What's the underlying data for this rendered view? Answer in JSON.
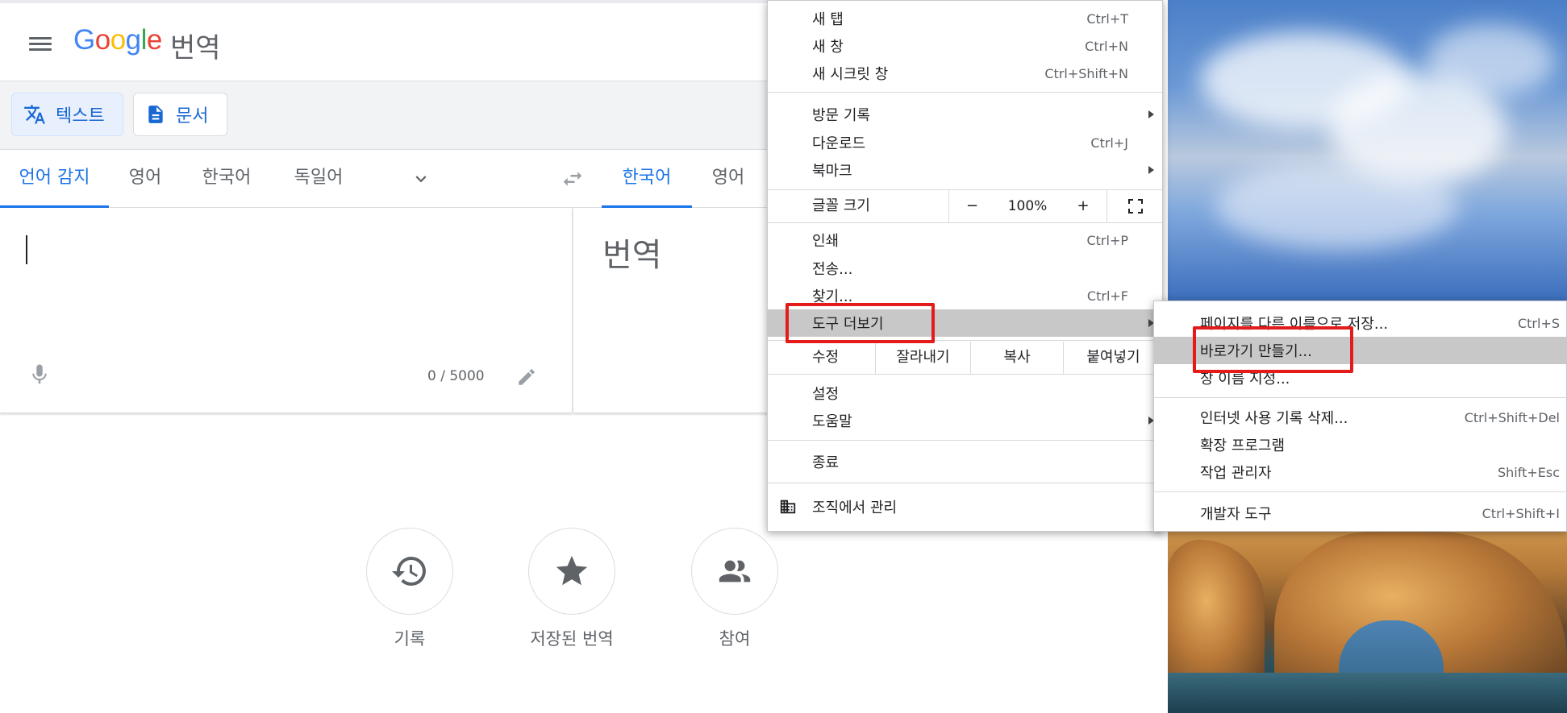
{
  "translate": {
    "logo": {
      "g": "G",
      "o1": "o",
      "o2": "o",
      "g2": "g",
      "l": "l",
      "e": "e"
    },
    "product_name": "번역",
    "modes": {
      "text": "텍스트",
      "document": "문서"
    },
    "source_langs": {
      "detect": "언어 감지",
      "english": "영어",
      "korean": "한국어",
      "german": "독일어"
    },
    "target_langs": {
      "korean": "한국어",
      "english": "영어"
    },
    "source_input": {
      "value": ""
    },
    "char_count": "0 / 5000",
    "target_placeholder": "번역",
    "actions": {
      "history": "기록",
      "saved": "저장된 번역",
      "community": "참여"
    },
    "colors": {
      "accent": "#1a73e8",
      "selected_bg": "#e8f0fe"
    }
  },
  "chrome_menu": {
    "items": {
      "new_tab": {
        "label": "새 탭",
        "shortcut": "Ctrl+T"
      },
      "new_window": {
        "label": "새 창",
        "shortcut": "Ctrl+N"
      },
      "incognito": {
        "label": "새 시크릿 창",
        "shortcut": "Ctrl+Shift+N"
      },
      "history": {
        "label": "방문 기록"
      },
      "downloads": {
        "label": "다운로드",
        "shortcut": "Ctrl+J"
      },
      "bookmarks": {
        "label": "북마크"
      },
      "print": {
        "label": "인쇄",
        "shortcut": "Ctrl+P"
      },
      "cast": {
        "label": "전송..."
      },
      "find": {
        "label": "찾기...",
        "shortcut": "Ctrl+F"
      },
      "more_tools": {
        "label": "도구 더보기"
      },
      "settings": {
        "label": "설정"
      },
      "help": {
        "label": "도움말"
      },
      "exit": {
        "label": "종료"
      },
      "managed": {
        "label": "조직에서 관리"
      }
    },
    "zoom": {
      "label": "글꼴 크기",
      "minus": "−",
      "value": "100%",
      "plus": "+"
    },
    "edit": {
      "label": "수정",
      "cut": "잘라내기",
      "copy": "복사",
      "paste": "붙여넣기"
    }
  },
  "tools_submenu": {
    "save_page": {
      "label": "페이지를 다른 이름으로 저장...",
      "shortcut": "Ctrl+S"
    },
    "create_shortcut": {
      "label": "바로가기 만들기..."
    },
    "name_window": {
      "label": "창 이름 지정..."
    },
    "clear_data": {
      "label": "인터넷 사용 기록 삭제...",
      "shortcut": "Ctrl+Shift+Del"
    },
    "extensions": {
      "label": "확장 프로그램"
    },
    "task_manager": {
      "label": "작업 관리자",
      "shortcut": "Shift+Esc"
    },
    "dev_tools": {
      "label": "개발자 도구",
      "shortcut": "Ctrl+Shift+I"
    }
  },
  "highlight_color": "#e31b1b"
}
